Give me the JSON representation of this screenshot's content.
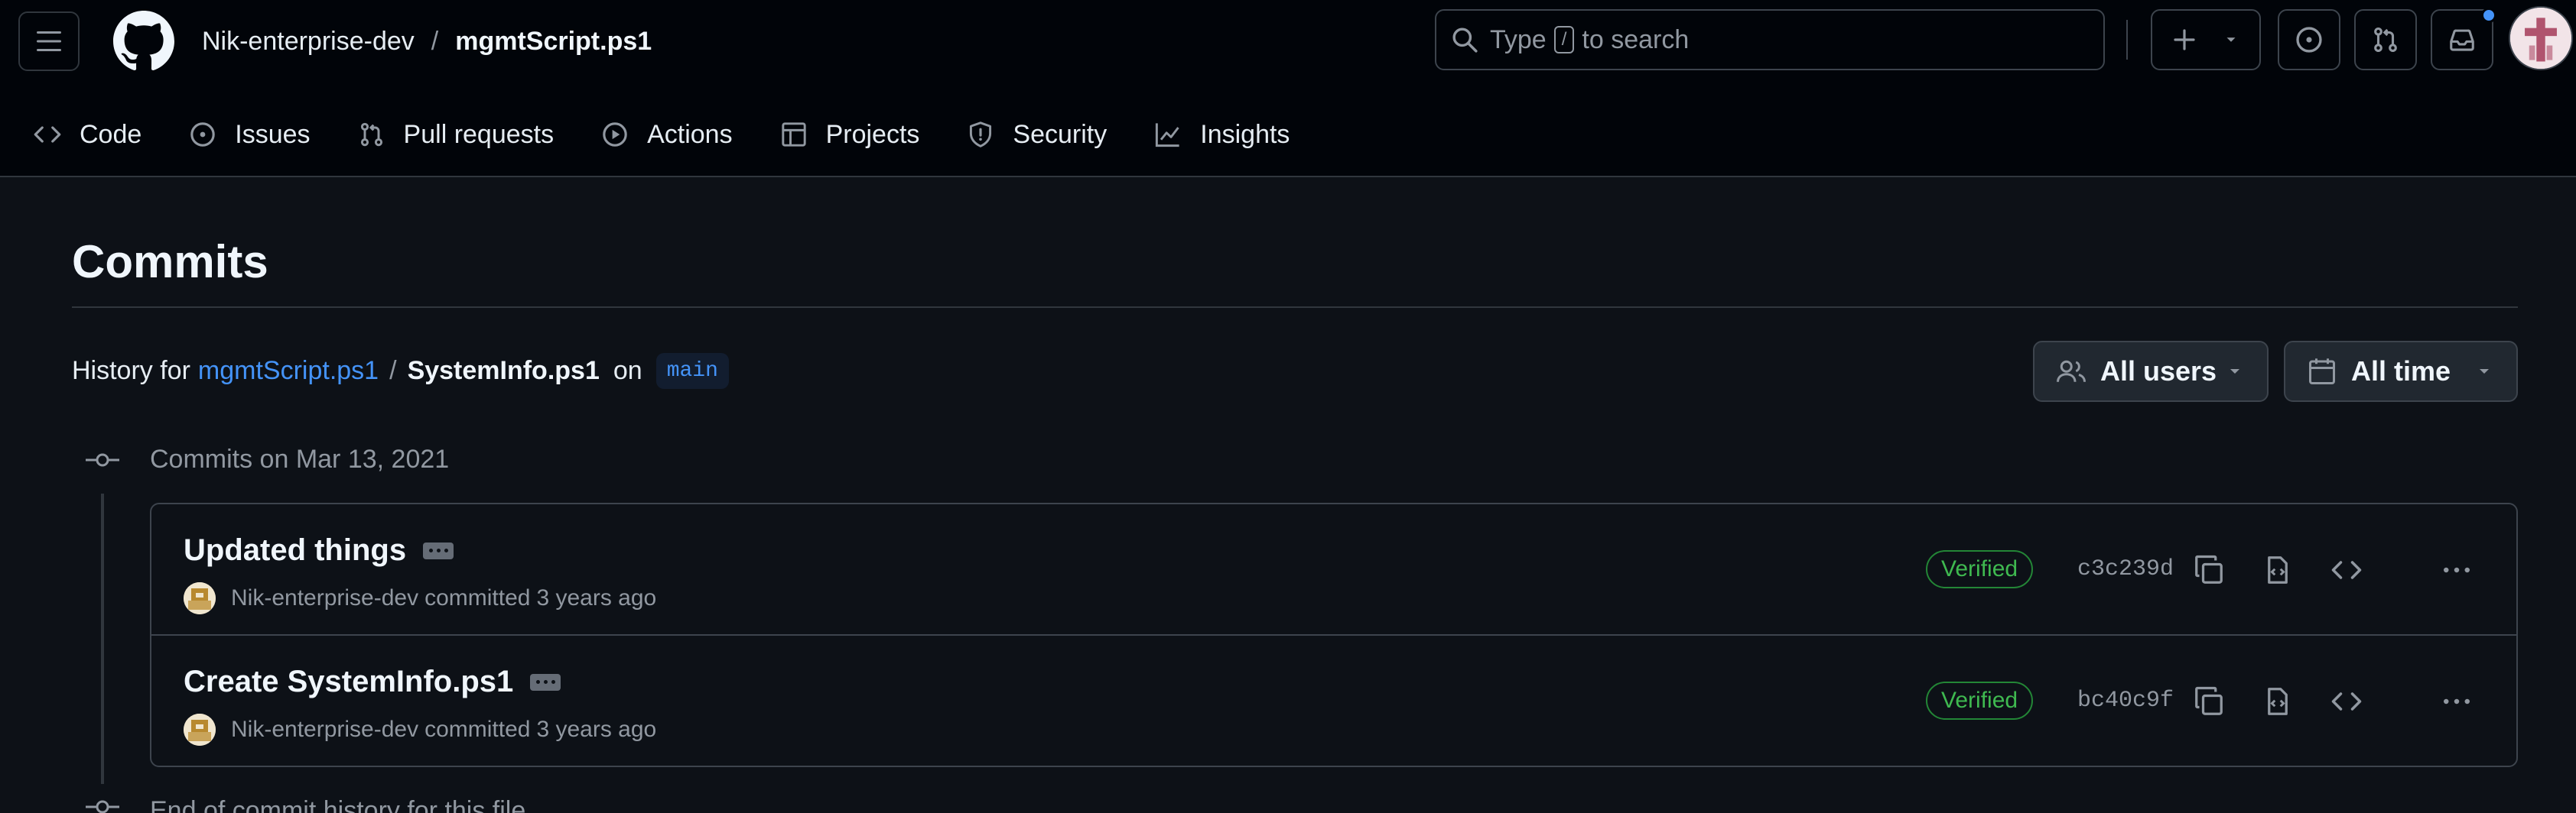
{
  "header": {
    "owner": "Nik-enterprise-dev",
    "separator": "/",
    "repo": "mgmtScript.ps1",
    "search": {
      "prefix": "Type",
      "key": "/",
      "suffix": "to search"
    }
  },
  "tabs": [
    {
      "label": "Code",
      "icon": "code-icon"
    },
    {
      "label": "Issues",
      "icon": "issue-icon"
    },
    {
      "label": "Pull requests",
      "icon": "pull-request-icon"
    },
    {
      "label": "Actions",
      "icon": "play-icon"
    },
    {
      "label": "Projects",
      "icon": "table-icon"
    },
    {
      "label": "Security",
      "icon": "shield-icon"
    },
    {
      "label": "Insights",
      "icon": "graph-icon"
    }
  ],
  "page": {
    "title": "Commits",
    "history_prefix": "History for",
    "history_repo": "mgmtScript.ps1",
    "history_sep": "/",
    "history_file": "SystemInfo.ps1",
    "history_on": "on",
    "branch": "main"
  },
  "filters": {
    "users": "All users",
    "time": "All time"
  },
  "group_label": "Commits on Mar 13, 2021",
  "end_label": "End of commit history for this file",
  "commits": [
    {
      "message": "Updated things",
      "author": "Nik-enterprise-dev",
      "action": "committed",
      "time": "3 years ago",
      "badge": "Verified",
      "sha": "c3c239d"
    },
    {
      "message": "Create SystemInfo.ps1",
      "author": "Nik-enterprise-dev",
      "action": "committed",
      "time": "3 years ago",
      "badge": "Verified",
      "sha": "bc40c9f"
    }
  ],
  "colors": {
    "accent": "#4493f8",
    "verified": "#3fb950",
    "background": "#0d1117",
    "header_bg": "#010409"
  }
}
